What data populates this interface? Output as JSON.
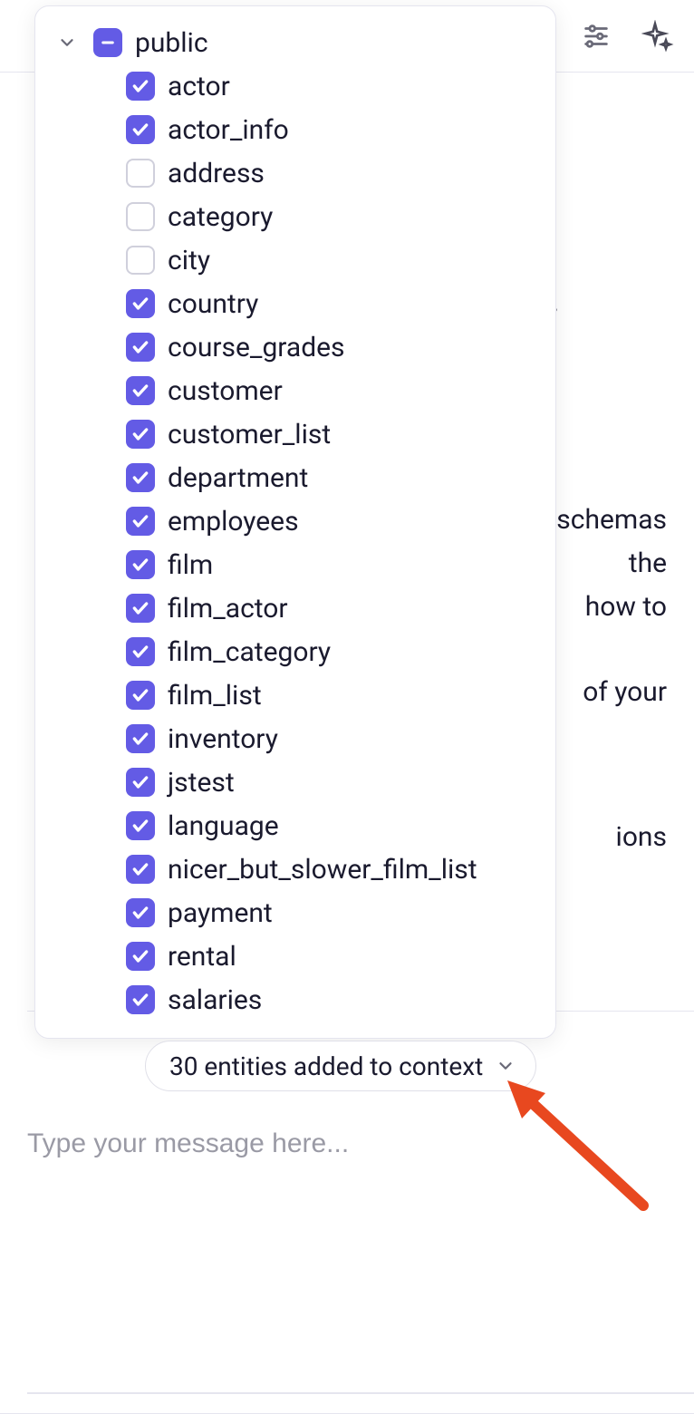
{
  "tree": {
    "root_label": "public",
    "root_state": "indeterminate",
    "items": [
      {
        "label": "actor",
        "checked": true
      },
      {
        "label": "actor_info",
        "checked": true
      },
      {
        "label": "address",
        "checked": false
      },
      {
        "label": "category",
        "checked": false
      },
      {
        "label": "city",
        "checked": false
      },
      {
        "label": "country",
        "checked": true
      },
      {
        "label": "course_grades",
        "checked": true
      },
      {
        "label": "customer",
        "checked": true
      },
      {
        "label": "customer_list",
        "checked": true
      },
      {
        "label": "department",
        "checked": true
      },
      {
        "label": "employees",
        "checked": true
      },
      {
        "label": "film",
        "checked": true
      },
      {
        "label": "film_actor",
        "checked": true
      },
      {
        "label": "film_category",
        "checked": true
      },
      {
        "label": "film_list",
        "checked": true
      },
      {
        "label": "inventory",
        "checked": true
      },
      {
        "label": "jstest",
        "checked": true
      },
      {
        "label": "language",
        "checked": true
      },
      {
        "label": "nicer_but_slower_film_list",
        "checked": true
      },
      {
        "label": "payment",
        "checked": true
      },
      {
        "label": "rental",
        "checked": true
      },
      {
        "label": "salaries",
        "checked": true
      }
    ]
  },
  "context_pill": "30 entities added to context",
  "message_placeholder": "Type your message here...",
  "background": {
    "heading_suffix": "ies.",
    "para1": "schemas\n the\n how to",
    "para2": " of your",
    "para3": "ions"
  }
}
